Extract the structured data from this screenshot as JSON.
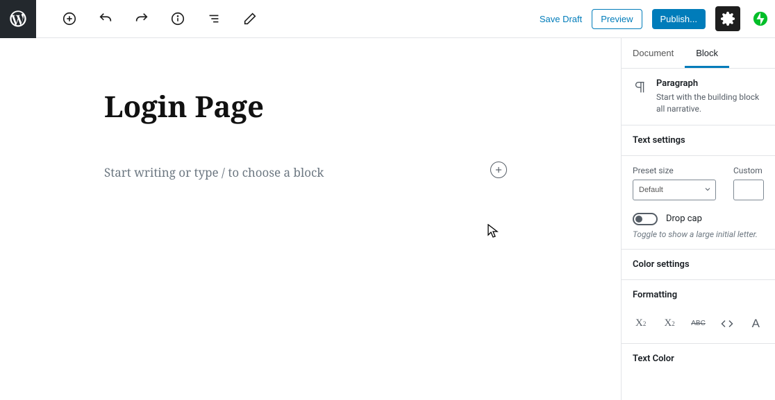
{
  "topbar": {
    "save_draft": "Save Draft",
    "preview": "Preview",
    "publish": "Publish..."
  },
  "editor": {
    "title": "Login Page",
    "placeholder": "Start writing or type / to choose a block"
  },
  "sidebar": {
    "tabs": {
      "document": "Document",
      "block": "Block"
    },
    "block_info": {
      "name": "Paragraph",
      "desc": "Start with the building block all narrative."
    },
    "text_settings": {
      "title": "Text settings",
      "preset_label": "Preset size",
      "preset_value": "Default",
      "custom_label": "Custom",
      "dropcap_label": "Drop cap",
      "dropcap_hint": "Toggle to show a large initial letter."
    },
    "color_settings": "Color settings",
    "formatting": "Formatting",
    "text_color": "Text Color"
  }
}
